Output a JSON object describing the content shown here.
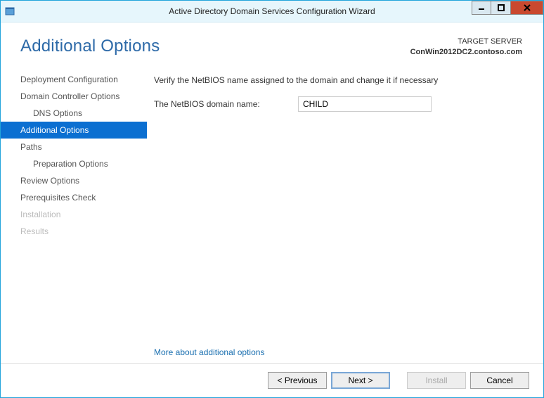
{
  "window": {
    "title": "Active Directory Domain Services Configuration Wizard"
  },
  "page": {
    "heading": "Additional Options",
    "target_label": "TARGET SERVER",
    "target_value": "ConWin2012DC2.contoso.com"
  },
  "nav": {
    "items": [
      {
        "label": "Deployment Configuration",
        "indent": false,
        "selected": false,
        "disabled": false
      },
      {
        "label": "Domain Controller Options",
        "indent": false,
        "selected": false,
        "disabled": false
      },
      {
        "label": "DNS Options",
        "indent": true,
        "selected": false,
        "disabled": false
      },
      {
        "label": "Additional Options",
        "indent": false,
        "selected": true,
        "disabled": false
      },
      {
        "label": "Paths",
        "indent": false,
        "selected": false,
        "disabled": false
      },
      {
        "label": "Preparation Options",
        "indent": true,
        "selected": false,
        "disabled": false
      },
      {
        "label": "Review Options",
        "indent": false,
        "selected": false,
        "disabled": false
      },
      {
        "label": "Prerequisites Check",
        "indent": false,
        "selected": false,
        "disabled": false
      },
      {
        "label": "Installation",
        "indent": false,
        "selected": false,
        "disabled": true
      },
      {
        "label": "Results",
        "indent": false,
        "selected": false,
        "disabled": true
      }
    ]
  },
  "content": {
    "instruction": "Verify the NetBIOS name assigned to the domain and change it if necessary",
    "netbios_label": "The NetBIOS domain name:",
    "netbios_value": "CHILD",
    "more_link": "More about additional options"
  },
  "footer": {
    "previous": "< Previous",
    "next": "Next >",
    "install": "Install",
    "cancel": "Cancel"
  }
}
